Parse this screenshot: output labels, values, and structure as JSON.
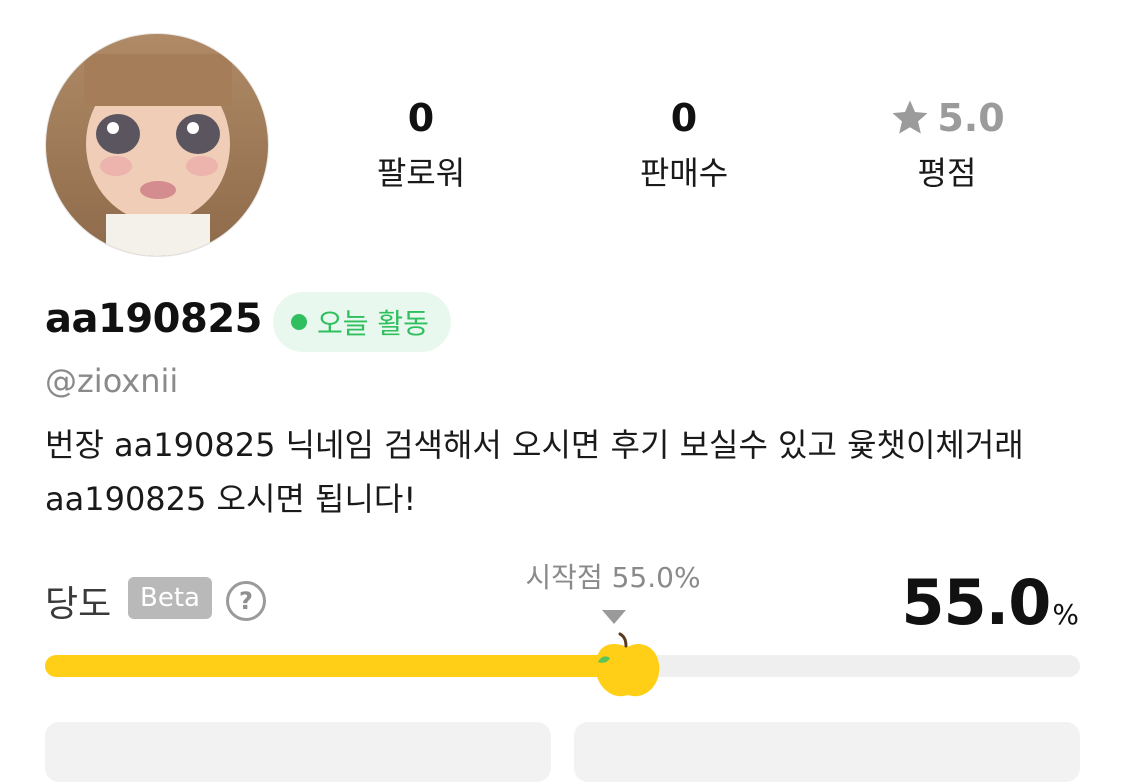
{
  "profile": {
    "avatar_icon": "doll-avatar",
    "username": "aa190825",
    "handle": "@zioxnii",
    "activity_badge": "오늘 활동",
    "bio": "번장 aa190825 닉네임 검색해서 오시면 후기 보실수 있고 윷챗이체거래 aa190825 오시면 됩니다!"
  },
  "stats": [
    {
      "value": "0",
      "label": "팔로워"
    },
    {
      "value": "0",
      "label": "판매수"
    },
    {
      "value": "5.0",
      "label": "평점",
      "icon": "star-icon"
    }
  ],
  "sugar": {
    "label": "당도",
    "badge": "Beta",
    "help_icon": "?",
    "start_label": "시작점 55.0%",
    "value": "55.0",
    "unit": "%",
    "level_percent": 55
  },
  "buttons": [
    {
      "label": ""
    },
    {
      "label": ""
    }
  ],
  "colors": {
    "accent_yellow": "#ffcf17",
    "active_green": "#2fbf5f",
    "track_gray": "#efefef"
  }
}
